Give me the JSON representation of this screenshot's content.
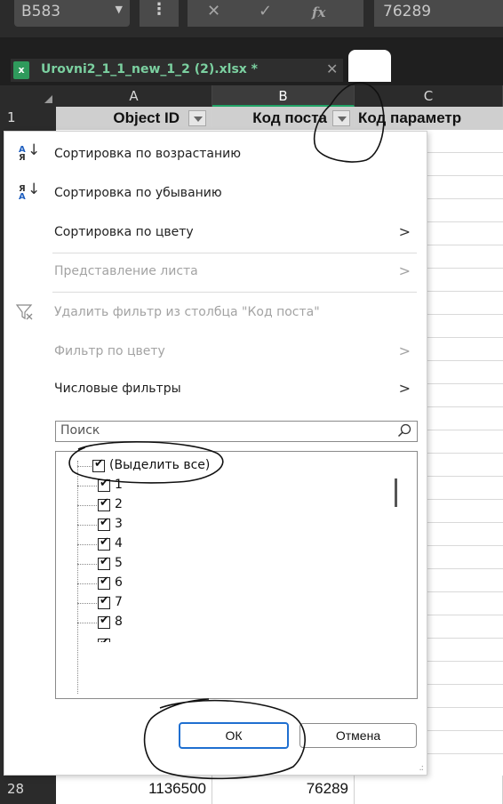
{
  "formula_bar": {
    "name_box": "B583",
    "dots": "⋮",
    "cancel_glyph": "✕",
    "enter_glyph": "✓",
    "fx_glyph": "fx",
    "value": "76289"
  },
  "tab": {
    "icon_letter": "x",
    "title": "Urovni2_1_1_new_1_2 (2).xlsx *",
    "close_glyph": "✕"
  },
  "columns": [
    "A",
    "B",
    "C"
  ],
  "header_row": {
    "row_number": "1",
    "a": "Object ID",
    "b": "Код поста",
    "c": "Код параметр"
  },
  "bottom_row": {
    "row_number": "28",
    "a": "1136500",
    "b": "76289"
  },
  "menu": {
    "sort_asc": "Сортировка по возрастанию",
    "sort_desc": "Сортировка по убыванию",
    "sort_color": "Сортировка по цвету",
    "sheet_view": "Представление листа",
    "clear_filter": "Удалить фильтр из столбца \"Код поста\"",
    "filter_color": "Фильтр по цвету",
    "number_filters": "Числовые фильтры",
    "sort_asc_icon_top": "А",
    "sort_asc_icon_bottom": "Я",
    "sort_desc_icon_top": "Я",
    "sort_desc_icon_bottom": "А",
    "arrow": "↓",
    "chevron": ">"
  },
  "search": {
    "placeholder": "Поиск"
  },
  "list": {
    "items": [
      "(Выделить все)",
      "1",
      "2",
      "3",
      "4",
      "5",
      "6",
      "7",
      "8"
    ]
  },
  "buttons": {
    "ok": "ОК",
    "cancel": "Отмена"
  }
}
